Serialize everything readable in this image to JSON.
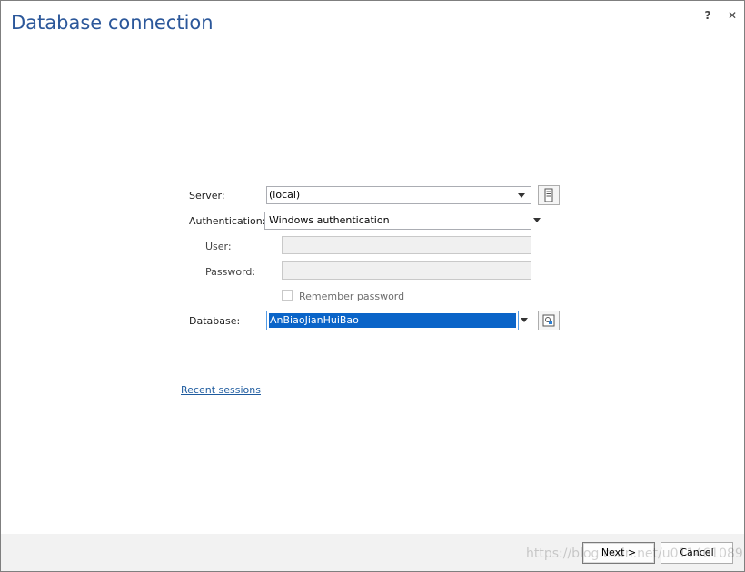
{
  "window": {
    "title": "Database connection",
    "help_glyph": "?",
    "close_glyph": "✕"
  },
  "form": {
    "server": {
      "label": "Server:",
      "value": "(local)"
    },
    "authentication": {
      "label": "Authentication:",
      "value": "Windows authentication"
    },
    "user": {
      "label": "User:",
      "value": ""
    },
    "password": {
      "label": "Password:",
      "value": ""
    },
    "remember_password": {
      "label": "Remember password",
      "checked": false
    },
    "database": {
      "label": "Database:",
      "value": "AnBiaoJianHuiBao"
    }
  },
  "links": {
    "recent_sessions": "Recent sessions"
  },
  "footer": {
    "next_label": "Next >",
    "cancel_label": "Cancel"
  },
  "watermark": "https://blog.csdn.net/u011461089",
  "icons": {
    "server_browse": "server-icon",
    "database_browse": "database-icon"
  }
}
